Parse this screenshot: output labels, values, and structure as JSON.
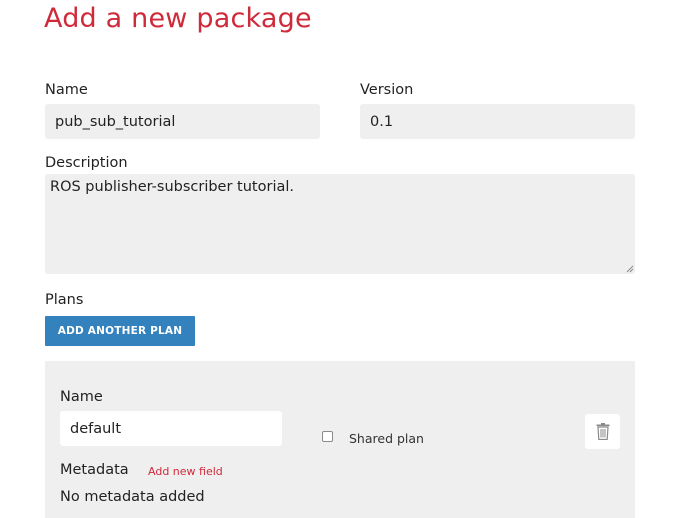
{
  "page": {
    "title": "Add a new package"
  },
  "form": {
    "name": {
      "label": "Name",
      "value": "pub_sub_tutorial"
    },
    "version": {
      "label": "Version",
      "value": "0.1"
    },
    "description": {
      "label": "Description",
      "value": "ROS publisher-subscriber tutorial."
    },
    "plans": {
      "label": "Plans",
      "add_button_label": "ADD ANOTHER PLAN",
      "items": [
        {
          "name_label": "Name",
          "name_value": "default",
          "shared_label": "Shared plan",
          "shared_checked": false,
          "delete_icon": "trash-icon",
          "metadata_label": "Metadata",
          "add_field_label": "Add new field",
          "metadata_empty_text": "No metadata added"
        }
      ]
    }
  },
  "colors": {
    "title": "#cf2a3a",
    "primary_button": "#3381bd",
    "field_background": "#efefef",
    "link": "#cf2a3a"
  }
}
